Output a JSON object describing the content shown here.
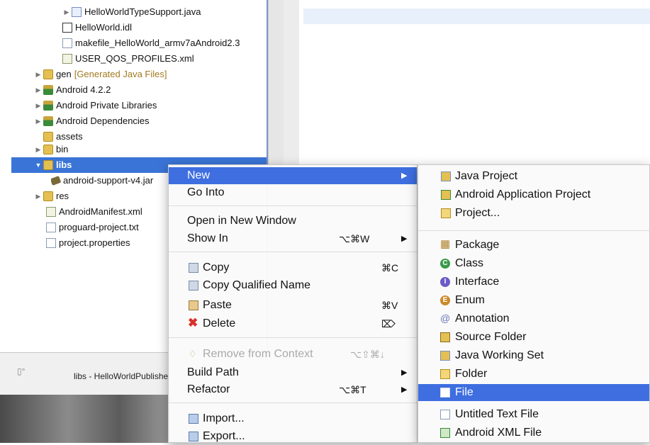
{
  "explorer": {
    "items": [
      {
        "label": "HelloWorldTypeSupport.java",
        "icon": "java-file-icon"
      },
      {
        "label": "HelloWorld.idl",
        "icon": "idl-file-icon"
      },
      {
        "label": "makefile_HelloWorld_armv7aAndroid2.3",
        "icon": "text-file-icon"
      },
      {
        "label": "USER_QOS_PROFILES.xml",
        "icon": "xml-file-icon"
      },
      {
        "label": "gen",
        "decoration": "[Generated Java Files]",
        "icon": "folder-icon"
      },
      {
        "label": "Android 4.2.2",
        "icon": "library-icon"
      },
      {
        "label": "Android Private Libraries",
        "icon": "library-icon"
      },
      {
        "label": "Android Dependencies",
        "icon": "library-icon"
      },
      {
        "label": "assets",
        "icon": "folder-icon"
      },
      {
        "label": "bin",
        "icon": "folder-icon"
      },
      {
        "label": "libs",
        "icon": "folder-icon"
      },
      {
        "label": "android-support-v4.jar",
        "icon": "jar-icon"
      },
      {
        "label": "res",
        "icon": "folder-icon"
      },
      {
        "label": "AndroidManifest.xml",
        "icon": "manifest-icon"
      },
      {
        "label": "proguard-project.txt",
        "icon": "text-file-icon"
      },
      {
        "label": "project.properties",
        "icon": "properties-file-icon"
      }
    ]
  },
  "status": {
    "text": "libs - HelloWorldPublisher"
  },
  "context_menu": {
    "items": [
      {
        "label": "New",
        "highlighted": true,
        "submenu": true
      },
      {
        "label": "Go Into"
      },
      {
        "label": "Open in New Window"
      },
      {
        "label": "Show In",
        "shortcut": "⌥⌘W",
        "submenu": true
      },
      {
        "label": "Copy",
        "shortcut": "⌘C",
        "icon": "copy-icon"
      },
      {
        "label": "Copy Qualified Name",
        "icon": "copy-qualified-icon"
      },
      {
        "label": "Paste",
        "shortcut": "⌘V",
        "icon": "paste-icon"
      },
      {
        "label": "Delete",
        "shortcut": "⌦",
        "icon": "delete-icon"
      },
      {
        "label": "Remove from Context",
        "shortcut": "⌥⇧⌘↓",
        "disabled": true,
        "icon": "remove-context-icon"
      },
      {
        "label": "Build Path",
        "submenu": true
      },
      {
        "label": "Refactor",
        "shortcut": "⌥⌘T",
        "submenu": true
      },
      {
        "label": "Import...",
        "icon": "import-icon"
      },
      {
        "label": "Export...",
        "icon": "export-icon"
      }
    ]
  },
  "new_submenu": {
    "items": [
      {
        "label": "Java Project",
        "icon": "java-project-icon"
      },
      {
        "label": "Android Application Project",
        "icon": "android-project-icon"
      },
      {
        "label": "Project...",
        "icon": "project-icon"
      },
      {
        "label": "Package",
        "icon": "package-icon"
      },
      {
        "label": "Class",
        "icon": "class-icon"
      },
      {
        "label": "Interface",
        "icon": "interface-icon"
      },
      {
        "label": "Enum",
        "icon": "enum-icon"
      },
      {
        "label": "Annotation",
        "icon": "annotation-icon"
      },
      {
        "label": "Source Folder",
        "icon": "source-folder-icon"
      },
      {
        "label": "Java Working Set",
        "icon": "working-set-icon"
      },
      {
        "label": "Folder",
        "icon": "folder-icon"
      },
      {
        "label": "File",
        "highlighted": true,
        "icon": "file-icon"
      },
      {
        "label": "Untitled Text File",
        "icon": "untitled-text-file-icon"
      },
      {
        "label": "Android XML File",
        "icon": "android-xml-file-icon"
      }
    ]
  },
  "colors": {
    "selection": "#3a74d6",
    "menu_highlight": "#3e6ee0",
    "delete": "#d9302a"
  }
}
